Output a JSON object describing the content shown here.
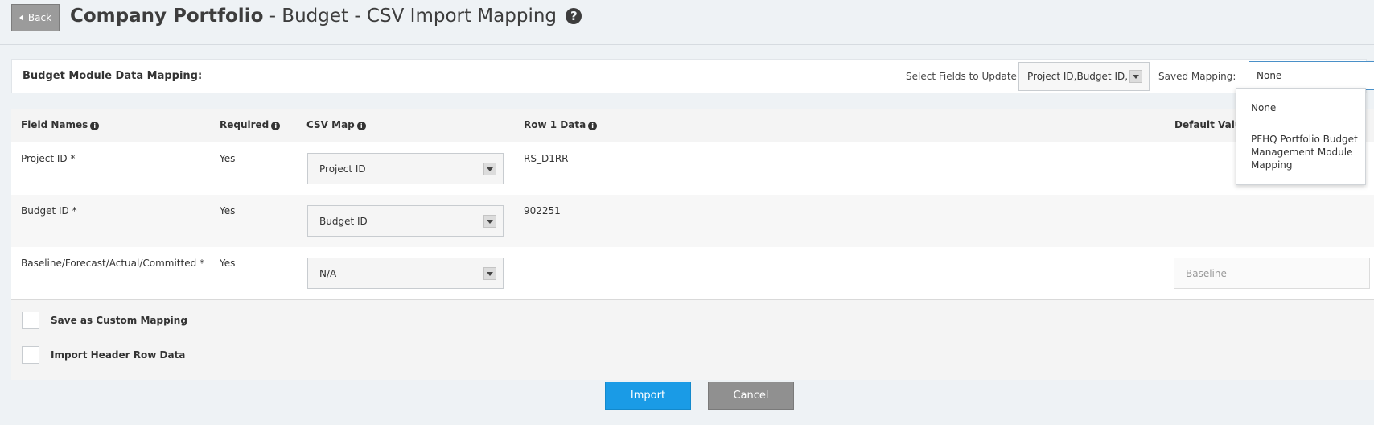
{
  "header": {
    "back_label": "Back",
    "title_bold": "Company Portfolio",
    "title_rest": " - Budget - CSV Import Mapping",
    "help_glyph": "?"
  },
  "mapping_bar": {
    "title": "Budget Module Data Mapping:",
    "fields_label": "Select Fields to Update:",
    "fields_value": "Project ID,Budget ID,...",
    "saved_label": "Saved Mapping:",
    "saved_value": "None"
  },
  "dropdown": {
    "options": [
      "None",
      "PFHQ Portfolio Budget Management Module Mapping"
    ]
  },
  "table": {
    "headers": {
      "field_names": "Field Names",
      "required": "Required",
      "csv_map": "CSV Map",
      "row1": "Row 1 Data",
      "default_value": "Default Value"
    },
    "rows": [
      {
        "field": "Project ID *",
        "required": "Yes",
        "csv": "Project ID",
        "row1": "RS_D1RR",
        "default": ""
      },
      {
        "field": "Budget ID *",
        "required": "Yes",
        "csv": "Budget ID",
        "row1": "902251",
        "default": ""
      },
      {
        "field": "Baseline/Forecast/Actual/Committed *",
        "required": "Yes",
        "csv": "N/A",
        "row1": "",
        "default": "Baseline"
      }
    ]
  },
  "options": {
    "save_custom": "Save as Custom Mapping",
    "import_header": "Import Header Row Data"
  },
  "buttons": {
    "import": "Import",
    "cancel": "Cancel"
  },
  "colors": {
    "import_bg": "#1a9be6",
    "cancel_bg": "#909090",
    "page_bg": "#eef2f5"
  }
}
